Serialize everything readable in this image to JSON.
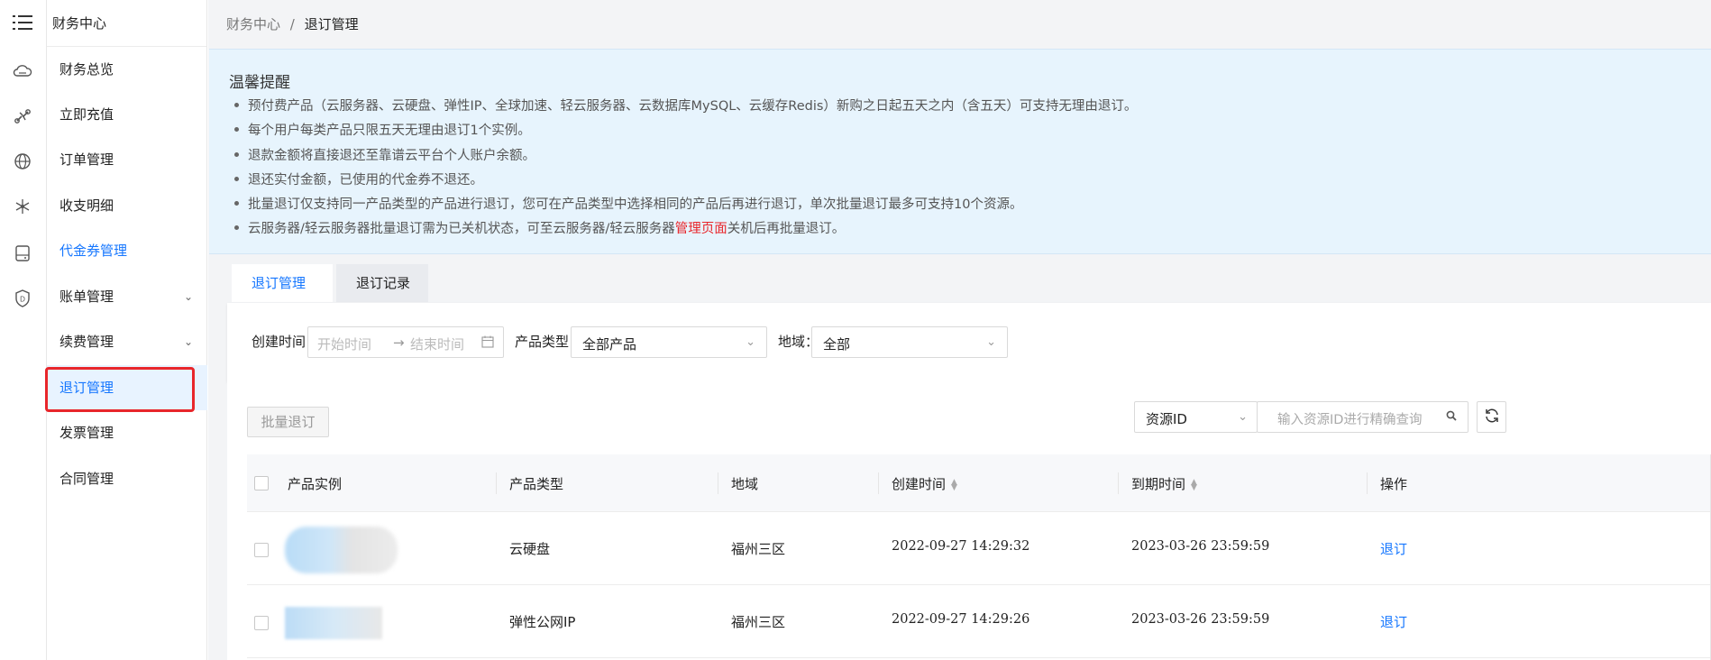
{
  "rail": {
    "icons": [
      "menu-icon",
      "cloud-storage-icon",
      "link-icon",
      "globe-icon",
      "network-icon",
      "disk-icon",
      "shield-icon"
    ]
  },
  "sidebar": {
    "header": "财务中心",
    "items": [
      {
        "label": "财务总览"
      },
      {
        "label": "立即充值"
      },
      {
        "label": "订单管理"
      },
      {
        "label": "收支明细"
      },
      {
        "label": "代金券管理"
      },
      {
        "label": "账单管理"
      },
      {
        "label": "续费管理"
      },
      {
        "label": "退订管理"
      },
      {
        "label": "发票管理"
      },
      {
        "label": "合同管理"
      }
    ]
  },
  "breadcrumb": {
    "parent": "财务中心",
    "sep": "/",
    "current": "退订管理"
  },
  "notice": {
    "title": "温馨提醒",
    "lines": [
      "预付费产品（云服务器、云硬盘、弹性IP、全球加速、轻云服务器、云数据库MySQL、云缓存Redis）新购之日起五天之内（含五天）可支持无理由退订。",
      "每个用户每类产品只限五天无理由退订1个实例。",
      "退款金额将直接退还至靠谱云平台个人账户余额。",
      "退还实付金额，已使用的代金券不退还。",
      "批量退订仅支持同一产品类型的产品进行退订，您可在产品类型中选择相同的产品后再进行退订，单次批量退订最多可支持10个资源。"
    ],
    "last_line_before": "云服务器/轻云服务器批量退订需为已关机状态，可至云服务器/轻云服务器",
    "last_line_link": "管理页面",
    "last_line_after": "关机后再批量退订。"
  },
  "tabs": [
    {
      "label": "退订管理"
    },
    {
      "label": "退订记录"
    }
  ],
  "filter": {
    "created_label": "创建时间：",
    "start_placeholder": "开始时间",
    "end_placeholder": "结束时间",
    "range_arrow": "→",
    "type_label": "产品类型：",
    "type_value": "全部产品",
    "region_label": "地域：",
    "region_value": "全部"
  },
  "toolbar": {
    "batch_label": "批量退订",
    "id_select": "资源ID",
    "search_placeholder": "输入资源ID进行精确查询"
  },
  "table": {
    "columns": [
      "产品实例",
      "产品类型",
      "地域",
      "创建时间",
      "到期时间",
      "操作"
    ],
    "rows": [
      {
        "type": "云硬盘",
        "region": "福州三区",
        "created": "2022-09-27 14:29:32",
        "expires": "2023-03-26 23:59:59",
        "action": "退订"
      },
      {
        "type": "弹性公网IP",
        "region": "福州三区",
        "created": "2022-09-27 14:29:26",
        "expires": "2023-03-26 23:59:59",
        "action": "退订"
      }
    ]
  },
  "colors": {
    "accent": "#1677ff",
    "highlight": "#e8262b",
    "notice_bg": "#e7f4fd"
  }
}
